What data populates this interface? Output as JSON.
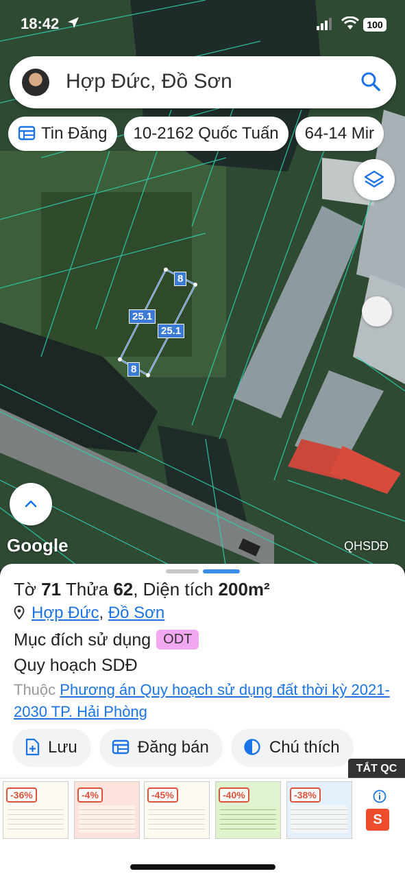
{
  "status": {
    "time": "18:42",
    "battery": "100"
  },
  "search": {
    "query": "Hợp Đức, Đồ Sơn"
  },
  "chips": [
    "Tin Đăng",
    "10-2162 Quốc Tuấn",
    "64-14 Mir"
  ],
  "parcel": {
    "edges": {
      "top": "8",
      "left": "25.1",
      "right": "25.1",
      "bottom": "8"
    }
  },
  "map": {
    "attribution": "Google",
    "layer_label": "QHSDĐ"
  },
  "sheet": {
    "title_prefix": "Tờ",
    "sheet_no": "71",
    "parcel_word": "Thửa",
    "parcel_no": "62",
    "area_label": ", Diện tích",
    "area_value": "200m²",
    "ward": "Hợp Đức",
    "separator": ",",
    "district": "Đồ Sơn",
    "purpose_label": "Mục đích sử dụng",
    "purpose_code": "ODT",
    "plan_label": "Quy hoạch SDĐ",
    "belong_label": "Thuộc",
    "belong_link": "Phương án Quy hoạch sử dụng đất thời kỳ 2021-2030 TP. Hải Phòng"
  },
  "actions": {
    "save": "Lưu",
    "sell": "Đăng bán",
    "legend": "Chú thích"
  },
  "ads": {
    "close_label": "TẮT QC",
    "discounts": [
      "-36%",
      "-4%",
      "-45%",
      "-40%",
      "-38%"
    ],
    "shop_letter": "S"
  },
  "colors": {
    "accent": "#1a73e8",
    "badge": "#f2a8f0",
    "shop": "#ee4d2d"
  }
}
